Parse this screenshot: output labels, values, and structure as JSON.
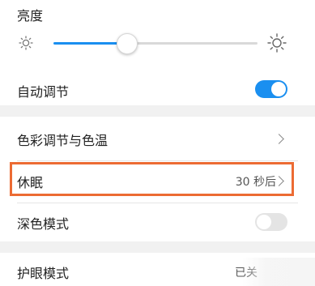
{
  "brightness": {
    "title": "亮度",
    "level_percent": 36,
    "low_icon": "sun-small-icon",
    "high_icon": "sun-large-icon"
  },
  "auto_adjust": {
    "label": "自动调节",
    "enabled": true
  },
  "color_temp": {
    "label": "色彩调节与色温",
    "icon": "chevron-right-icon"
  },
  "sleep": {
    "label": "休眠",
    "value": "30 秒后",
    "icon": "chevron-right-icon"
  },
  "dark_mode": {
    "label": "深色模式",
    "enabled": false
  },
  "eye_comfort": {
    "label": "护眼模式",
    "value": "已关"
  },
  "colors": {
    "accent": "#1a8ff0",
    "toggle_off": "#e4e4e4",
    "highlight": "#ec6b33",
    "track_off": "#d9d9d9"
  }
}
